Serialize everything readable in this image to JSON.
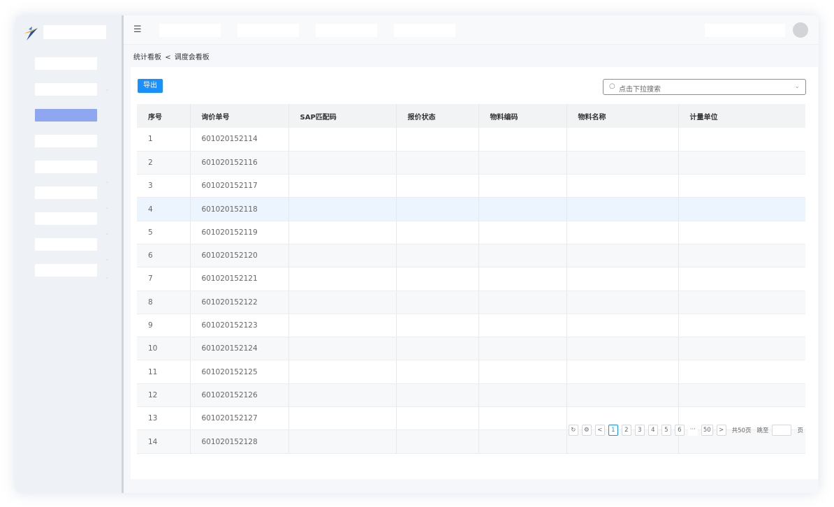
{
  "topbar": {
    "menu_icon": "menu-fold-icon"
  },
  "breadcrumb": {
    "parent": "统计看板",
    "separator": "<",
    "current": "调度会看板"
  },
  "toolbar": {
    "export_label": "导出"
  },
  "search": {
    "placeholder": "点击下拉搜索",
    "icon": "search-icon"
  },
  "table": {
    "headers": [
      "序号",
      "询价单号",
      "SAP匹配码",
      "报价状态",
      "物料编码",
      "物料名称",
      "计量单位"
    ],
    "rows": [
      [
        "1",
        "601020152114"
      ],
      [
        "2",
        "601020152116"
      ],
      [
        "3",
        "601020152117"
      ],
      [
        "4",
        "601020152118"
      ],
      [
        "5",
        "601020152119"
      ],
      [
        "6",
        "601020152120"
      ],
      [
        "7",
        "601020152121"
      ],
      [
        "8",
        "601020152122"
      ],
      [
        "9",
        "601020152123"
      ],
      [
        "10",
        "601020152124"
      ],
      [
        "11",
        "601020152125"
      ],
      [
        "12",
        "601020152126"
      ],
      [
        "13",
        "601020152127"
      ],
      [
        "14",
        "601020152128"
      ]
    ],
    "highlighted_row": 4
  },
  "pagination": {
    "refresh_icon": "refresh-icon",
    "settings_icon": "settings-icon",
    "prev": "<",
    "pages": [
      "1",
      "2",
      "3",
      "4",
      "5",
      "6"
    ],
    "ellipsis": "···",
    "last": "50",
    "next": ">",
    "total_text": "共50页",
    "jump_label": "跳至",
    "page_suffix": "页",
    "current": "1"
  },
  "colors": {
    "accent": "#1890ff",
    "sidebar_active": "#8ea7f0",
    "row_highlight": "#ecf4fd"
  }
}
